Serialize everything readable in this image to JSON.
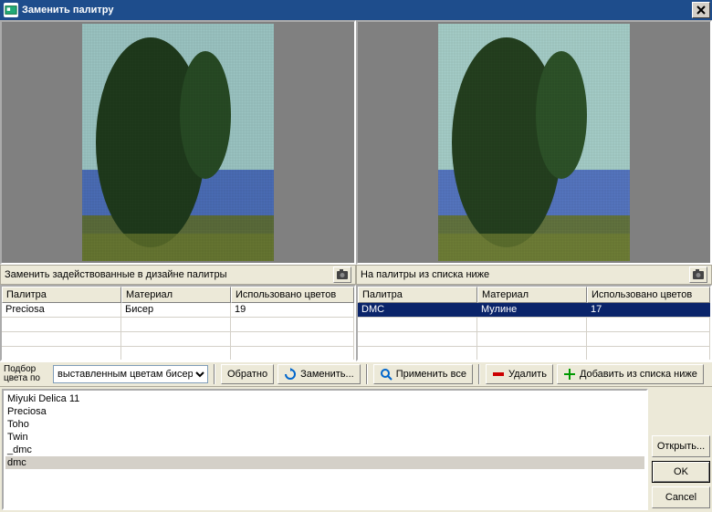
{
  "window": {
    "title": "Заменить палитру"
  },
  "sections": {
    "left_header": "Заменить задействованные в дизайне палитры",
    "right_header": "На палитры из списка ниже"
  },
  "table_headers": {
    "palette": "Палитра",
    "material": "Материал",
    "colors": "Использовано цветов"
  },
  "left_table_rows": [
    {
      "palette": "Preciosa",
      "material": "Бисер",
      "colors": "19"
    }
  ],
  "right_table_rows": [
    {
      "palette": "DMC",
      "material": "Мулине",
      "colors": "17"
    }
  ],
  "toolbar": {
    "pick_label": "Подбор цвета по",
    "combo_value": "выставленным цветам бисера",
    "back": "Обратно",
    "replace": "Заменить...",
    "apply_all": "Применить все",
    "delete": "Удалить",
    "add": "Добавить из списка ниже"
  },
  "listbox_items": [
    "Miyuki Delica 11",
    "Preciosa",
    "Toho",
    "Twin",
    "_dmc",
    "dmc"
  ],
  "listbox_selected_index": 5,
  "side_buttons": {
    "open": "Открыть...",
    "ok": "OK",
    "cancel": "Cancel"
  },
  "icons": {
    "camera": "camera-icon",
    "refresh": "refresh-icon",
    "magnify": "magnify-icon",
    "delete": "delete-icon",
    "add": "add-icon"
  }
}
